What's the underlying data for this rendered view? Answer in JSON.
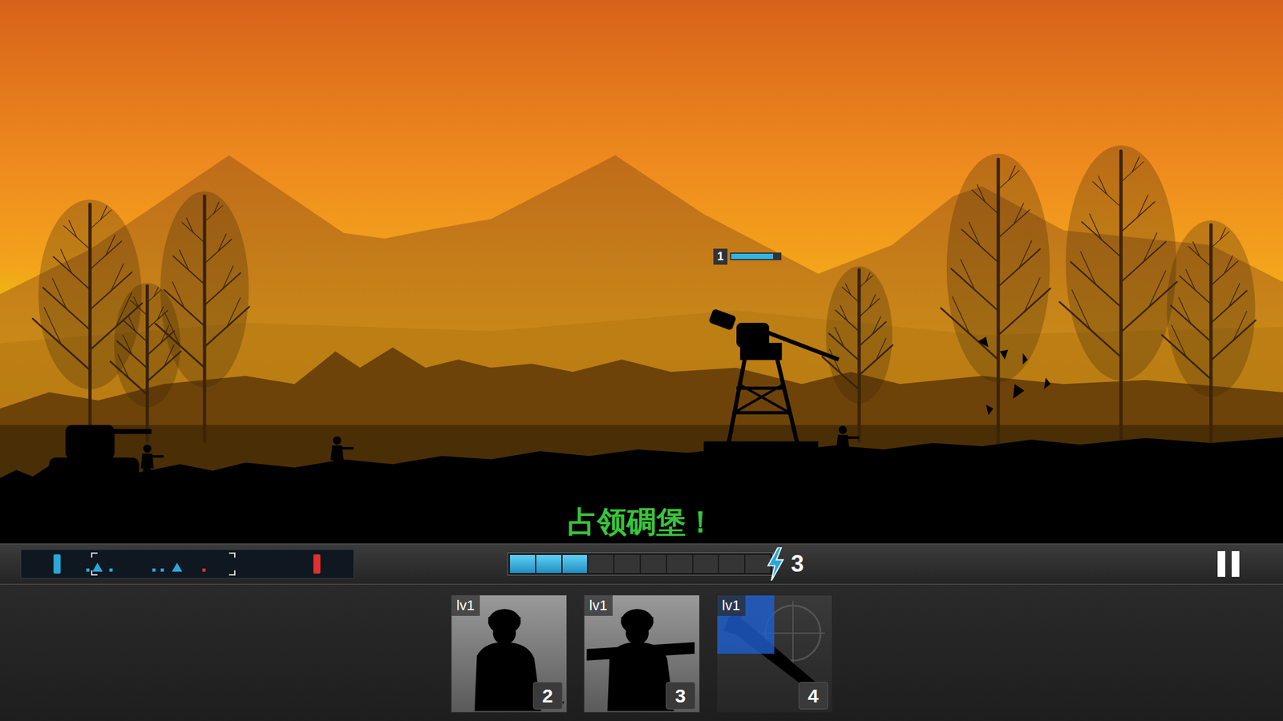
{
  "scene": {
    "objective": "占领碉堡！",
    "bunker": {
      "level": "1",
      "health": 0.85
    }
  },
  "hud": {
    "minimap": {
      "viewport": {
        "start": 0.21,
        "end": 0.645
      },
      "markers": [
        {
          "kind": "base",
          "color": "#2aa8d8",
          "level": 0.108
        },
        {
          "kind": "soldier",
          "color": "#2aa8d8",
          "level": 0.2
        },
        {
          "kind": "vehicle",
          "color": "#2aa8d8",
          "level": 0.23
        },
        {
          "kind": "soldier",
          "color": "#2aa8d8",
          "level": 0.27
        },
        {
          "kind": "soldier",
          "color": "#2aa8d8",
          "level": 0.4
        },
        {
          "kind": "soldier",
          "color": "#2aa8d8",
          "level": 0.425
        },
        {
          "kind": "vehicle",
          "color": "#2aa8d8",
          "level": 0.47
        },
        {
          "kind": "soldier",
          "color": "#e03030",
          "level": 0.55
        },
        {
          "kind": "base",
          "color": "#e03030",
          "level": 0.89
        }
      ]
    },
    "energy": {
      "level": 0.3,
      "count": "3"
    }
  },
  "cards": [
    {
      "level": "lv1",
      "cost": "2",
      "kind": "rifleman",
      "cooldown": 0
    },
    {
      "level": "lv1",
      "cost": "3",
      "kind": "bazooka",
      "cooldown": 0
    },
    {
      "level": "lv1",
      "cost": "4",
      "kind": "airstrike",
      "cooldown": 0.5
    }
  ]
}
